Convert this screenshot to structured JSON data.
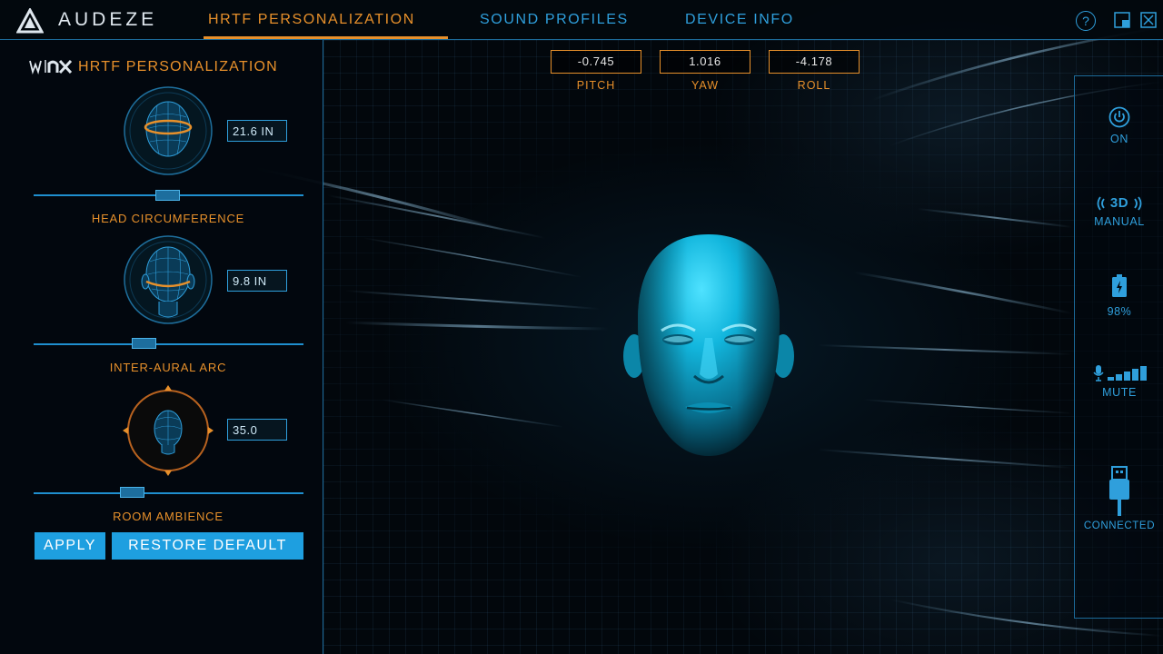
{
  "app": {
    "brand": "AUDEZE"
  },
  "nav": {
    "tabs": [
      {
        "label": "HRTF PERSONALIZATION",
        "active": true
      },
      {
        "label": "SOUND PROFILES",
        "active": false
      },
      {
        "label": "DEVICE INFO",
        "active": false
      }
    ],
    "help_label": "?"
  },
  "left_panel": {
    "logo_mark": "W|nx",
    "title": "HRTF PERSONALIZATION",
    "head_circumference": {
      "value": "21.6 IN",
      "label": "HEAD CIRCUMFERENCE",
      "slider_fraction": 0.5
    },
    "inter_aural_arc": {
      "value": "9.8 IN",
      "label": "INTER-AURAL ARC",
      "slider_fraction": 0.41
    },
    "room_ambience": {
      "value": "35.0",
      "label": "ROOM AMBIENCE",
      "slider_fraction": 0.37
    },
    "apply_label": "APPLY",
    "restore_label": "RESTORE DEFAULT"
  },
  "tracking": {
    "pitch": {
      "value": "-0.745",
      "label": "PITCH"
    },
    "yaw": {
      "value": "1.016",
      "label": "YAW"
    },
    "roll": {
      "value": "-4.178",
      "label": "ROLL"
    }
  },
  "status": {
    "power": {
      "label": "ON",
      "icon": "power-icon"
    },
    "mode": {
      "label": "MANUAL",
      "badge": "3D",
      "icon": "3d-icon"
    },
    "battery": {
      "label": "98%",
      "icon": "battery-icon"
    },
    "mic": {
      "label": "MUTE",
      "icon": "mic-level-icon"
    },
    "connection": {
      "label": "CONNECTED",
      "icon": "usb-icon"
    }
  },
  "colors": {
    "accent_orange": "#e7902b",
    "accent_blue": "#2f9fdc",
    "button_blue": "#1e9fe0",
    "head_cyan": "#12b6dd"
  }
}
